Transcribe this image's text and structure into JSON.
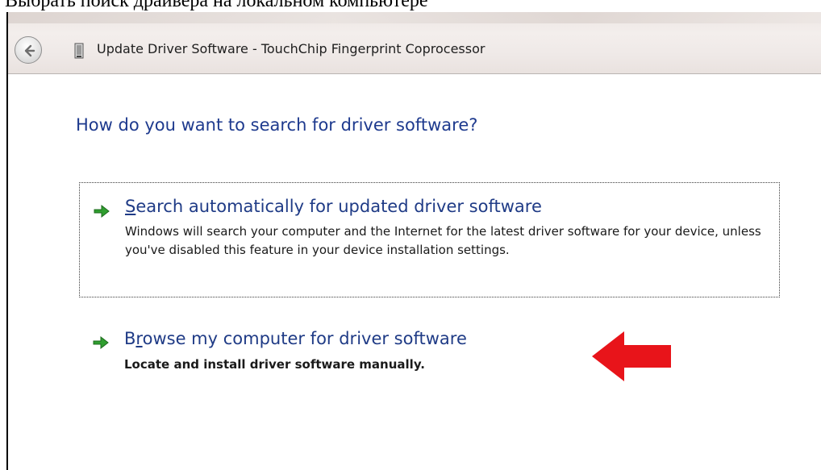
{
  "caption": "Выбрать поиск драйвера на локальном компьютере",
  "window": {
    "title": "Update Driver Software - TouchChip Fingerprint Coprocessor",
    "back_icon": "back-arrow-icon",
    "device_icon": "device-icon"
  },
  "heading": "How do you want to search for driver software?",
  "options": [
    {
      "title_first": "S",
      "title_rest": "earch automatically for updated driver software",
      "description": "Windows will search your computer and the Internet for the latest driver software for your device, unless you've disabled this feature in your device installation settings.",
      "icon": "green-arrow-icon"
    },
    {
      "title_first": "B",
      "title_underlined": "r",
      "title_rest": "owse my computer for driver software",
      "description": "Locate and install driver software manually.",
      "icon": "green-arrow-icon"
    }
  ],
  "colors": {
    "heading": "#1e3a8e",
    "link": "#1f3b86",
    "green_arrow": "#2f9e2f",
    "red_arrow": "#e8141a"
  }
}
